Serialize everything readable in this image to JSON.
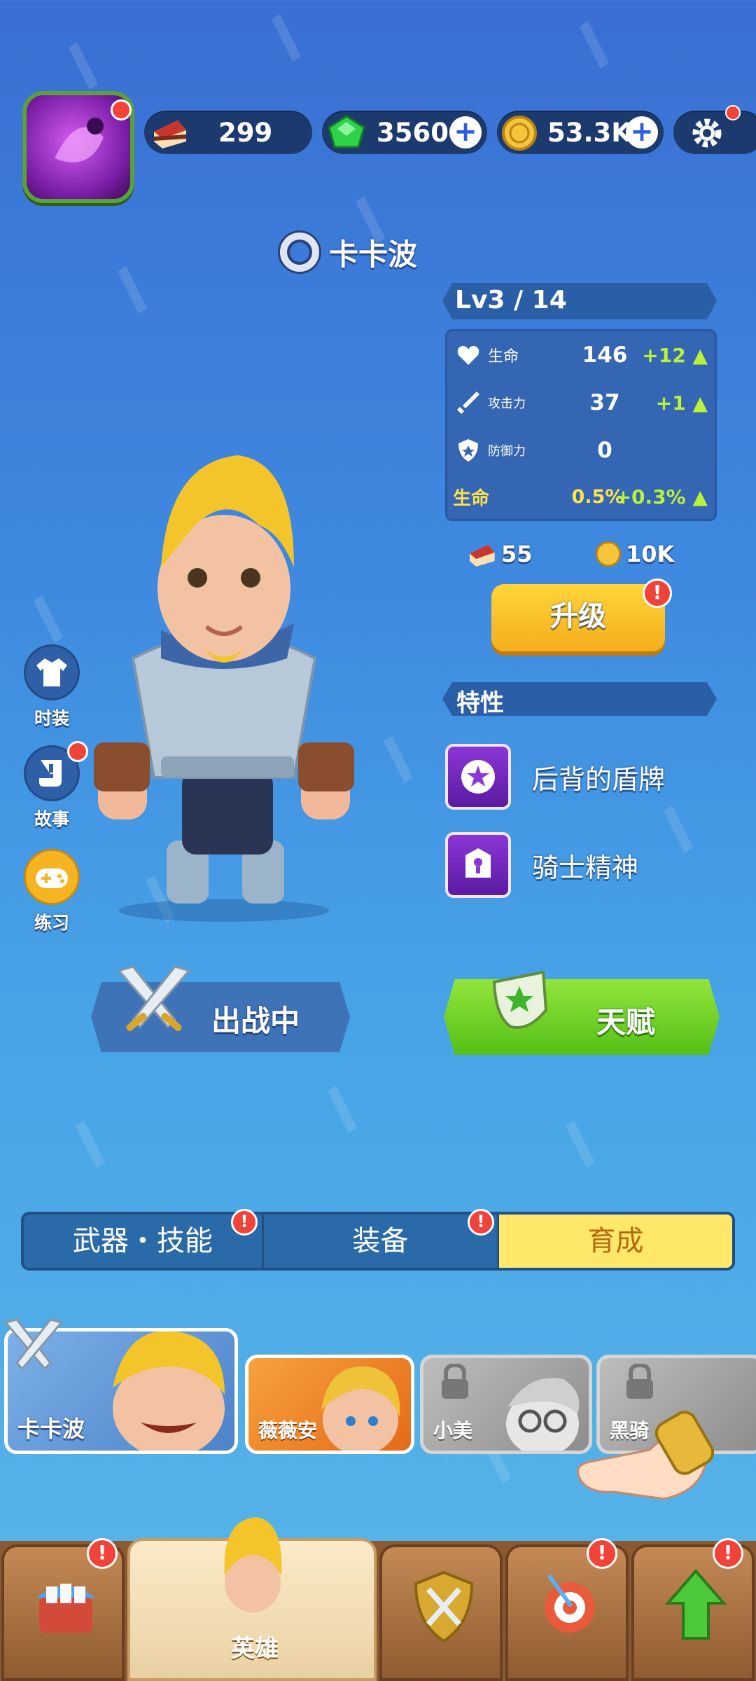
{
  "resources": {
    "cake_count": "299",
    "gems": "3560",
    "coins": "53.3K"
  },
  "hero": {
    "name": "卡卡波",
    "level": "Lv3 / 14",
    "stats": [
      {
        "label": "生命",
        "value": "146",
        "bonus": "+12"
      },
      {
        "label": "攻击力",
        "value": "37",
        "bonus": "+1"
      },
      {
        "label": "防御力",
        "value": "0",
        "bonus": ""
      }
    ],
    "growth": {
      "label": "生命",
      "value": "0.5%",
      "bonus": "+0.3%"
    },
    "upgrade_cost_cake": "55",
    "upgrade_cost_coin": "10K",
    "upgrade_label": "升级",
    "traits_title": "特性",
    "traits": [
      "后背的盾牌",
      "骑士精神"
    ]
  },
  "side_menu": [
    "时装",
    "故事",
    "练习"
  ],
  "actions": {
    "deploy": "出战中",
    "talent": "天赋"
  },
  "tabs": [
    "武器・技能",
    "装备",
    "育成"
  ],
  "active_tab": "育成",
  "hero_cards": [
    "卡卡波",
    "薇薇安",
    "小美",
    "黑骑"
  ],
  "bottom_nav": {
    "selected_label": "英雄"
  },
  "colors": {
    "accent_green": "#b8f23a",
    "alert_red": "#f0443a",
    "tab_active": "#ffe76a"
  }
}
